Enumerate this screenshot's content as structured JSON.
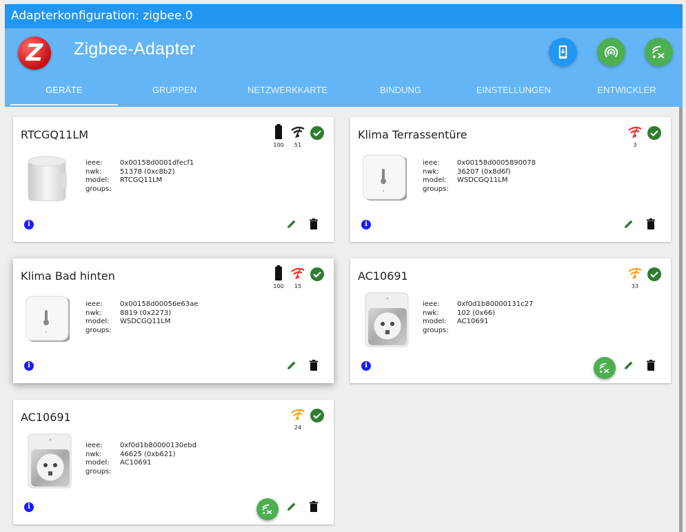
{
  "window": {
    "title": "Adapterkonfiguration: zigbee.0"
  },
  "header": {
    "logo_letter": "Z",
    "app_title": "Zigbee-Adapter",
    "buttons": [
      {
        "icon": "phone-download-icon",
        "color": "#2196f3"
      },
      {
        "icon": "pairing-icon",
        "color": "#4caf50"
      },
      {
        "icon": "touchlink-reset-icon",
        "color": "#4caf50"
      }
    ]
  },
  "tabs": [
    {
      "label": "GERÄTE",
      "active": true
    },
    {
      "label": "GRUPPEN",
      "active": false
    },
    {
      "label": "NETZWERKKARTE",
      "active": false
    },
    {
      "label": "BINDUNG",
      "active": false
    },
    {
      "label": "EINSTELLUNGEN",
      "active": false
    },
    {
      "label": "ENTWICKLER",
      "active": false
    }
  ],
  "labels": {
    "ieee": "ieee:",
    "nwk": "nwk:",
    "model": "model:",
    "groups": "groups:"
  },
  "colors": {
    "ok": "#2e7d32",
    "link_good": "#212121",
    "link_bad": "#e53935",
    "link_medium": "#f5a623",
    "edit": "#2e7d32"
  },
  "devices": [
    {
      "name": "RTCGQ11LM",
      "ieee": "0x00158d0001dfecf1",
      "nwk": "51378 (0xc8b2)",
      "model": "RTCGQ11LM",
      "groups": "",
      "battery": "100",
      "link_quality": "51",
      "link_color": "#212121",
      "image": "motion-sensor",
      "has_link_button": false
    },
    {
      "name": "Klima Terrassentüre",
      "ieee": "0x00158d0005890078",
      "nwk": "36207 (0x8d6f)",
      "model": "WSDCGQ11LM",
      "groups": "",
      "battery": null,
      "link_quality": "3",
      "link_color": "#e53935",
      "image": "climate-sensor",
      "has_link_button": false
    },
    {
      "name": "Klima Bad hinten",
      "ieee": "0x00158d00056e63ae",
      "nwk": "8819 (0x2273)",
      "model": "WSDCGQ11LM",
      "groups": "",
      "battery": "100",
      "link_quality": "15",
      "link_color": "#e53935",
      "image": "climate-sensor",
      "has_link_button": false
    },
    {
      "name": "AC10691",
      "ieee": "0xf0d1b80000131c27",
      "nwk": "102 (0x66)",
      "model": "AC10691",
      "groups": "",
      "battery": null,
      "link_quality": "33",
      "link_color": "#f5a623",
      "image": "smart-plug",
      "has_link_button": true
    },
    {
      "name": "AC10691",
      "ieee": "0xf0d1b80000130ebd",
      "nwk": "46625 (0xb621)",
      "model": "AC10691",
      "groups": "",
      "battery": null,
      "link_quality": "24",
      "link_color": "#f5a623",
      "image": "smart-plug",
      "has_link_button": true
    }
  ]
}
